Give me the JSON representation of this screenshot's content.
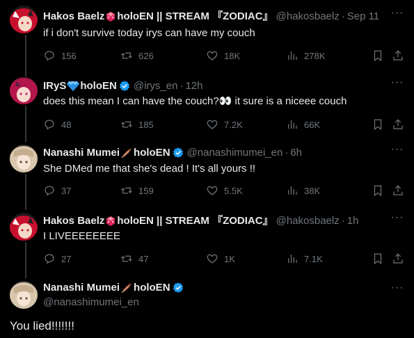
{
  "thread": [
    {
      "name": "Hakos Baelz",
      "name_suffix": "holoEN || STREAM 『ZODIAC』",
      "handle": "@hakosbaelz",
      "time": "Sep 11",
      "text": "if i don't survive today irys can have my couch",
      "replies": "156",
      "retweets": "626",
      "likes": "18K",
      "views": "278K",
      "avatar_color": "#c8102e",
      "gem_color": "#e0245e"
    },
    {
      "name": "IRyS",
      "name_suffix": "holoEN",
      "handle": "@irys_en",
      "time": "12h",
      "text": "does this mean I can have the couch?👀 it sure is a niceee couch",
      "replies": "48",
      "retweets": "185",
      "likes": "7.2K",
      "views": "66K",
      "avatar_color": "#d12c5c",
      "gem_color": "#4fb3ff"
    },
    {
      "name": "Nanashi Mumei",
      "name_suffix": "holoEN",
      "handle": "@nanashimumei_en",
      "time": "6h",
      "text": "She DMed me that she's dead ! It's all yours !!",
      "replies": "37",
      "retweets": "159",
      "likes": "5.5K",
      "views": "38K",
      "avatar_color": "#c9b49a",
      "gem_color": "#8b4a2b"
    },
    {
      "name": "Hakos Baelz",
      "name_suffix": "holoEN || STREAM 『ZODIAC』",
      "handle": "@hakosbaelz",
      "time": "1h",
      "text": "I LIVEEEEEEEE",
      "replies": "27",
      "retweets": "47",
      "likes": "1K",
      "views": "7.1K",
      "avatar_color": "#c8102e",
      "gem_color": "#e0245e"
    }
  ],
  "main_tweet": {
    "name": "Nanashi Mumei",
    "name_suffix": "holoEN",
    "handle": "@nanashimumei_en",
    "text": "You lied!!!!!!!"
  },
  "colors": {
    "background": "#000000",
    "text": "#e7e9ea",
    "muted": "#71767b",
    "verified": "#1d9bf0",
    "line": "#333639"
  }
}
